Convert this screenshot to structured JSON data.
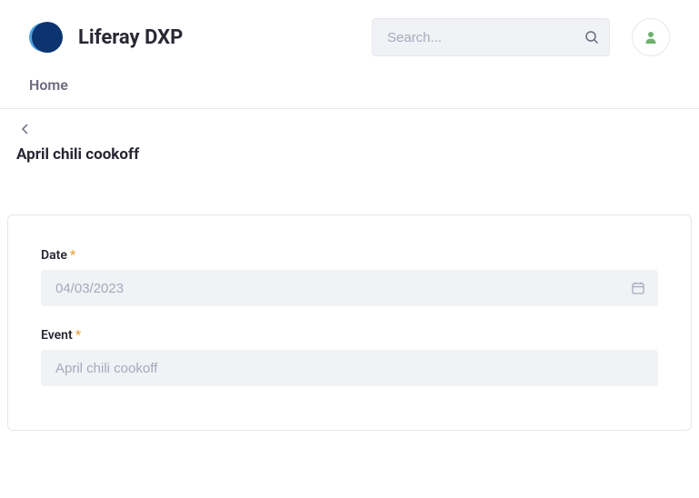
{
  "header": {
    "brand_title": "Liferay DXP",
    "search_placeholder": "Search..."
  },
  "nav": {
    "home_label": "Home"
  },
  "page": {
    "title": "April chili cookoff"
  },
  "form": {
    "date": {
      "label": "Date",
      "value": "04/03/2023"
    },
    "event": {
      "label": "Event",
      "value": "April chili cookoff"
    }
  }
}
